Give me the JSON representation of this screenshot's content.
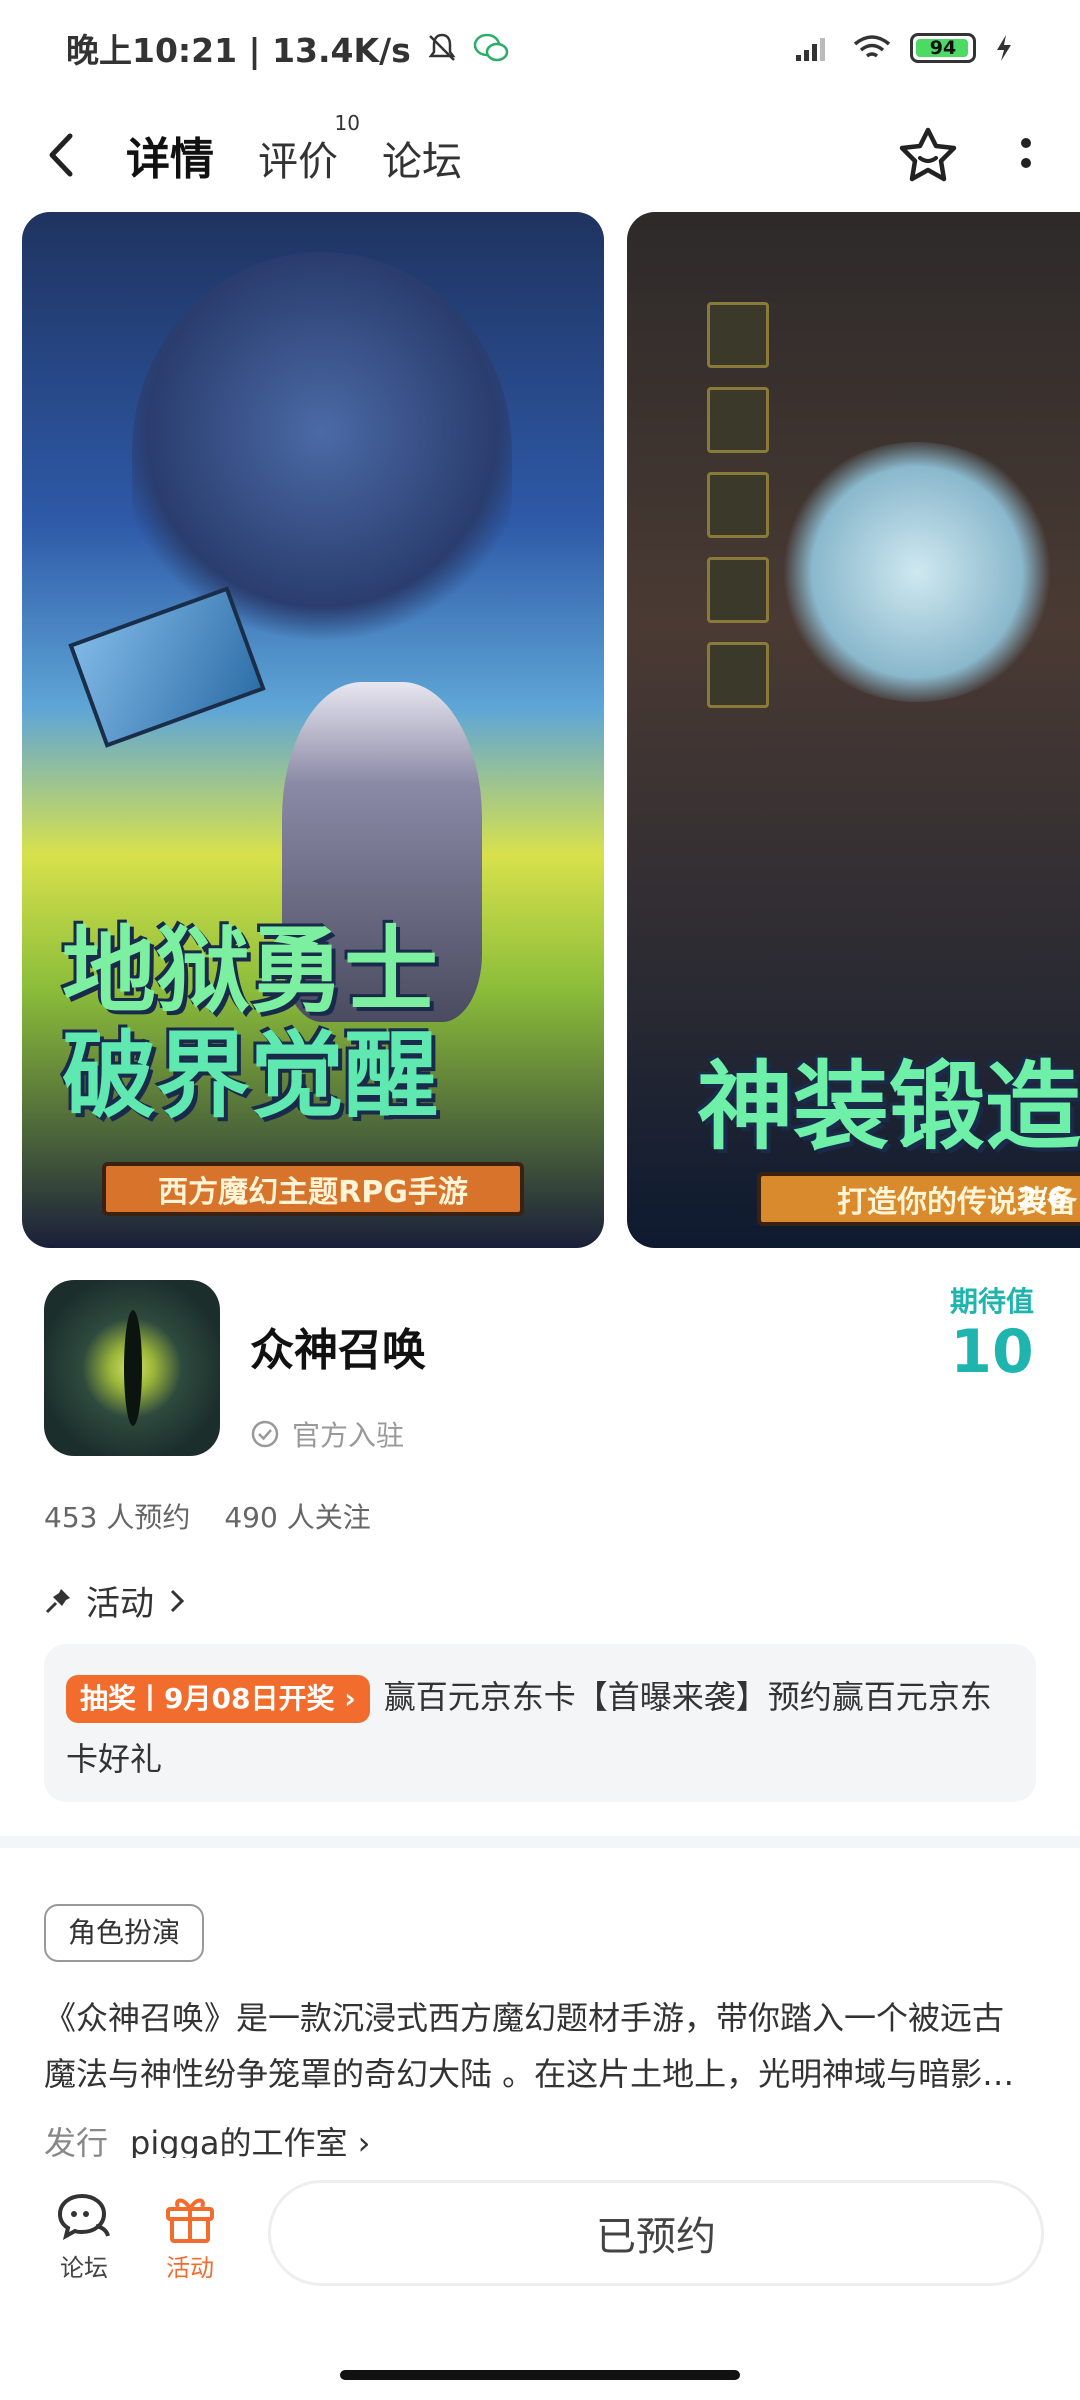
{
  "status_bar": {
    "time_speed": "晚上10:21 | 13.4K/s",
    "battery": "94"
  },
  "nav": {
    "tabs": [
      {
        "label": "详情",
        "active": true
      },
      {
        "label": "评价",
        "badge": "10"
      },
      {
        "label": "论坛"
      }
    ]
  },
  "screenshots": {
    "shot1_title_line1": "地狱勇士",
    "shot1_title_line2": "破界觉醒",
    "shot1_subtitle": "西方魔幻主题RPG手游",
    "shot2_title": "神装锻造",
    "shot2_subtitle": "打造你的传说装备",
    "counter": "2/6"
  },
  "app": {
    "name": "众神召唤",
    "official": "官方入驻",
    "expect_label": "期待值",
    "expect_value": "10",
    "reservations": "453 人预约",
    "followers": "490 人关注"
  },
  "activity": {
    "heading": "活动",
    "pill": "抽奖丨9月08日开奖 ›",
    "text": "赢百元京东卡【首曝来袭】预约赢百元京东卡好礼"
  },
  "details": {
    "tag": "角色扮演",
    "description": "《众神召唤》是一款沉浸式西方魔幻题材手游，带你踏入一个被远古魔法与神性纷争笼罩的奇幻大陆 。在这片土地上，光明神域与暗影…",
    "publisher_label": "发行",
    "publisher": "pigga的工作室 ›"
  },
  "bottom_bar": {
    "forum_label": "论坛",
    "activity_label": "活动",
    "reserve_label": "已预约"
  },
  "colors": {
    "accent": "#1fc3bd",
    "expect": "#1fb5ae",
    "activity_orange": "#f26c2e"
  }
}
